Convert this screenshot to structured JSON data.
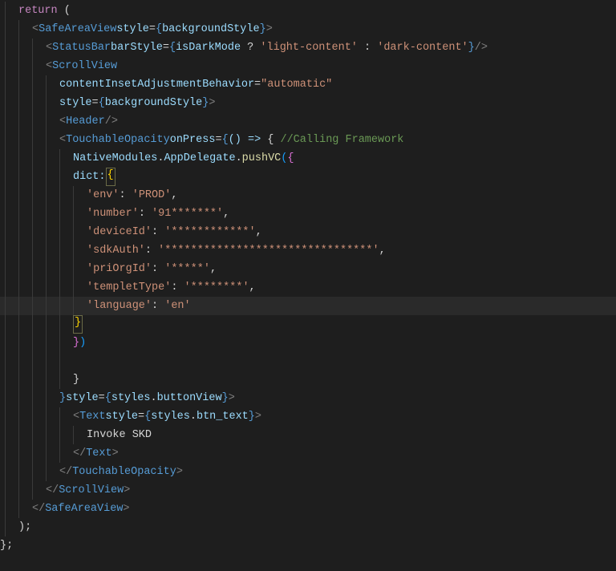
{
  "code": {
    "l1_return": "return",
    "l1_paren": " (",
    "l2_tag": "SafeAreaView",
    "l2_attr": "style",
    "l2_val": "backgroundStyle",
    "l3_tag": "StatusBar",
    "l3_attr": "barStyle",
    "l3_ident": "isDarkMode",
    "l3_q": " ? ",
    "l3_s1": "'light-content'",
    "l3_colon": " : ",
    "l3_s2": "'dark-content'",
    "l4_tag": "ScrollView",
    "l5_attr": "contentInsetAdjustmentBehavior",
    "l5_val": "\"automatic\"",
    "l6_attr": "style",
    "l6_val": "backgroundStyle",
    "l7_tag": "Header",
    "l8_tag": "TouchableOpacity",
    "l8_attr": "onPress",
    "l8_arrow": "() => ",
    "l8_cmt": "//Calling Framework",
    "l9_nm": "NativeModules",
    "l9_ad": "AppDelegate",
    "l9_fn": "pushVC",
    "l10_key": "dict:",
    "kv": [
      {
        "k": "'env'",
        "v": "'PROD'"
      },
      {
        "k": "'number'",
        "v": "'91*******'"
      },
      {
        "k": "'deviceId'",
        "v": "'************'"
      },
      {
        "k": "'sdkAuth'",
        "v": "'********************************'"
      },
      {
        "k": "'priOrgId'",
        "v": "'*****'"
      },
      {
        "k": "'templetType'",
        "v": "'********'"
      },
      {
        "k": "'language'",
        "v": "'en'"
      }
    ],
    "l22_style": "style",
    "l22_styles": "styles",
    "l22_btnview": "buttonView",
    "l23_tag": "Text",
    "l23_style": "style",
    "l23_styles": "styles",
    "l23_btntext": "btn_text",
    "l24_txt": "Invoke SKD",
    "l25_close_text": "Text",
    "l26_close_touch": "TouchableOpacity",
    "l27_close_scroll": "ScrollView",
    "l28_close_safe": "SafeAreaView"
  }
}
